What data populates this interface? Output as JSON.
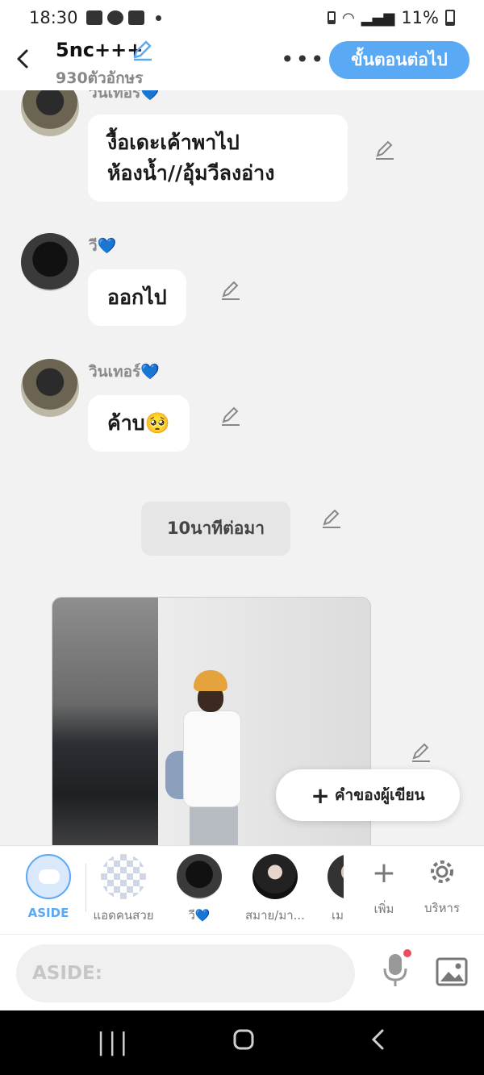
{
  "status": {
    "time": "18:30",
    "battery": "11%"
  },
  "header": {
    "title": "5nc+++",
    "subtitle": "930ตัวอักษร",
    "next_label": "ขั้นตอนต่อไป"
  },
  "messages": [
    {
      "sender": "วินเทอร์💙",
      "text_lines": [
        "งื้อเดะเค้าพาไป",
        "ห้องน้ำ//อุ้มวีลงอ่าง"
      ]
    },
    {
      "sender": "วี💙",
      "text": "ออกไป"
    },
    {
      "sender": "วินเทอร์💙",
      "text": "ค้าบ🥺"
    }
  ],
  "narration": "10นาทีต่อมา",
  "writer_button": {
    "plus": "+",
    "label": "คำของผู้เขียน"
  },
  "characters": [
    {
      "name": "ASIDE"
    },
    {
      "name": "แอดคนสวย"
    },
    {
      "name": "วี💙"
    },
    {
      "name": "สมาย/มา..."
    },
    {
      "name": "เม"
    }
  ],
  "tools": [
    {
      "icon": "plus-icon",
      "label": "เพิ่ม"
    },
    {
      "icon": "gear-icon",
      "label": "บริหาร"
    }
  ],
  "input": {
    "placeholder": "ASIDE:"
  }
}
